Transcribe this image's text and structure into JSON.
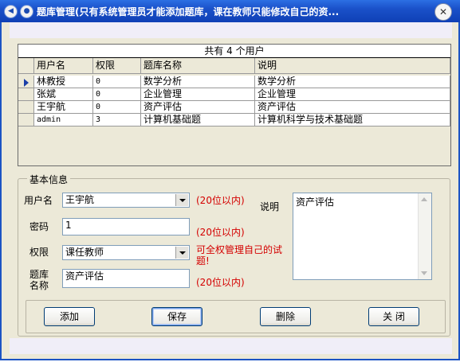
{
  "window": {
    "title": "题库管理(只有系统管理员才能添加题库，课在教师只能修改自己的资..."
  },
  "grid": {
    "caption": "共有 4 个用户",
    "columns": [
      "用户名",
      "权限",
      "题库名称",
      "说明"
    ],
    "rows": [
      {
        "user": "林教授",
        "perm": "0",
        "bank": "数学分析",
        "desc": "数学分析",
        "selected": true
      },
      {
        "user": "张斌",
        "perm": "0",
        "bank": "企业管理",
        "desc": "企业管理",
        "selected": false
      },
      {
        "user": "王宇航",
        "perm": "0",
        "bank": "资产评估",
        "desc": "资产评估",
        "selected": false
      },
      {
        "user": "admin",
        "perm": "3",
        "bank": "计算机基础题",
        "desc": "计算机科学与技术基础题",
        "selected": false
      }
    ]
  },
  "form": {
    "group_title": "基本信息",
    "username_label": "用户名",
    "username_value": "王宇航",
    "username_hint": "(20位以内)",
    "password_label": "密码",
    "password_value": "1",
    "password_hint": "(20位以内)",
    "perm_label": "权限",
    "perm_value": "课任教师",
    "perm_hint": "可全权管理自己的试题!",
    "bank_label_1": "题库",
    "bank_label_2": "名称",
    "bank_value": "资产评估",
    "bank_hint": "(20位以内)",
    "desc_label": "说明",
    "desc_value": "资产评估"
  },
  "buttons": {
    "add": "添加",
    "save": "保存",
    "delete": "删除",
    "close": "关 闭"
  },
  "icons": {
    "title_left_1": "system-menu-icon",
    "title_left_2": "pin-icon",
    "title_close": "close-icon",
    "row_selector": "current-row-arrow-icon"
  }
}
